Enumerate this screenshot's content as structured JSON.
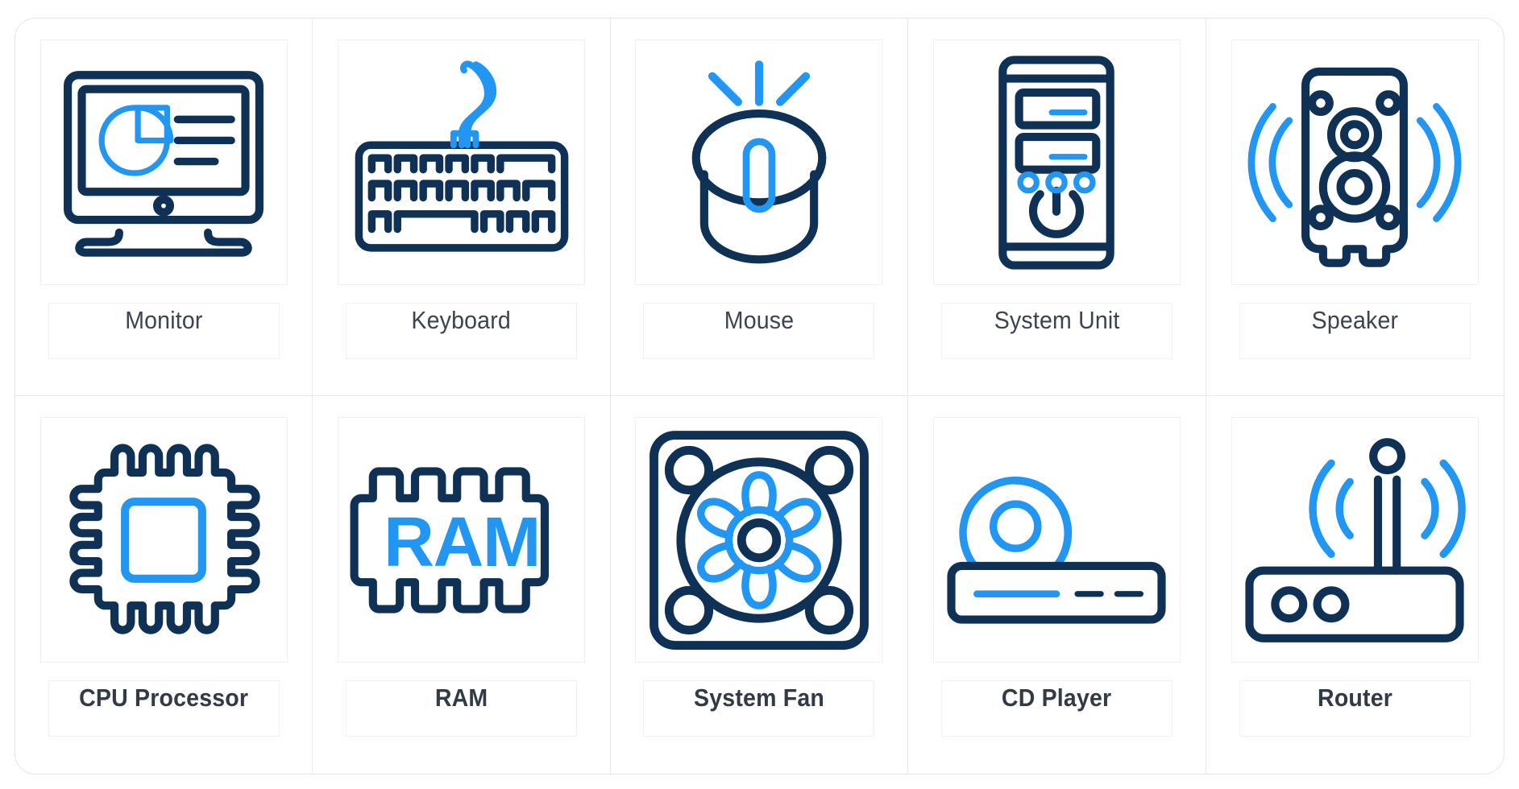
{
  "palette": {
    "navy": "#0f3156",
    "blue": "#2196f3",
    "blue_light": "#29a3f5",
    "grid_line": "#e6e8ea",
    "frame_border": "#e3e5e8",
    "box_border": "#f0f1f2",
    "label_color": "#3b4450",
    "background": "#ffffff"
  },
  "grid": {
    "columns": 5,
    "rows": 2
  },
  "icons": [
    {
      "id": "monitor",
      "label": "Monitor",
      "icon_name": "monitor-icon",
      "bold": false,
      "row": 1,
      "col": 1
    },
    {
      "id": "keyboard",
      "label": "Keyboard",
      "icon_name": "keyboard-icon",
      "bold": false,
      "row": 1,
      "col": 2
    },
    {
      "id": "mouse",
      "label": "Mouse",
      "icon_name": "mouse-icon",
      "bold": false,
      "row": 1,
      "col": 3
    },
    {
      "id": "system-unit",
      "label": "System Unit",
      "icon_name": "system-unit-icon",
      "bold": false,
      "row": 1,
      "col": 4
    },
    {
      "id": "speaker",
      "label": "Speaker",
      "icon_name": "speaker-icon",
      "bold": false,
      "row": 1,
      "col": 5
    },
    {
      "id": "cpu-processor",
      "label": "CPU Processor",
      "icon_name": "cpu-processor-icon",
      "bold": true,
      "row": 2,
      "col": 1
    },
    {
      "id": "ram",
      "label": "RAM",
      "icon_name": "ram-icon",
      "bold": true,
      "row": 2,
      "col": 2
    },
    {
      "id": "system-fan",
      "label": "System Fan",
      "icon_name": "system-fan-icon",
      "bold": true,
      "row": 2,
      "col": 3
    },
    {
      "id": "cd-player",
      "label": "CD Player",
      "icon_name": "cd-player-icon",
      "bold": true,
      "row": 2,
      "col": 4
    },
    {
      "id": "router",
      "label": "Router",
      "icon_name": "router-icon",
      "bold": true,
      "row": 2,
      "col": 5
    }
  ],
  "ram_icon_text": "RAM"
}
